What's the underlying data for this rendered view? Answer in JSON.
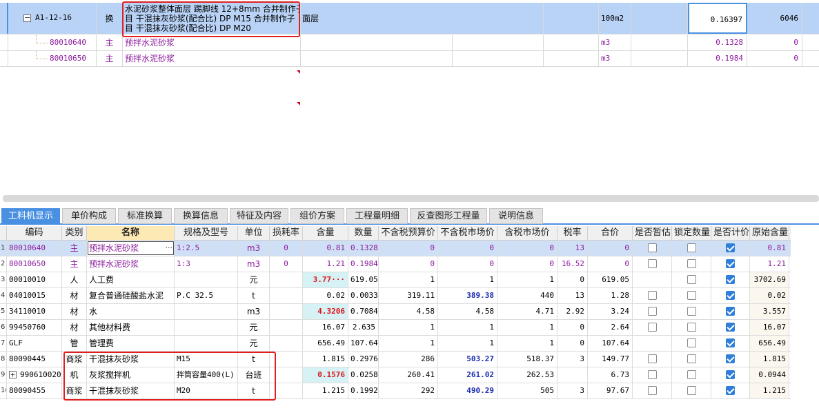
{
  "top": {
    "row1": {
      "code": "A1-12-16",
      "type": "换",
      "name_lines": [
        "水泥砂浆整体面层 踢脚线 12+8mm  合并制作子",
        "目 干混抹灰砂浆(配合比) DP M15  合并制作子",
        "目 干混抹灰砂浆(配合比) DP M20"
      ],
      "name_suffix": "面层",
      "unit": "100m2",
      "value": "0.16397",
      "amount": "6046"
    },
    "rows": [
      {
        "code": "80010640",
        "type": "主",
        "name": "预拌水泥砂浆",
        "unit": "m3",
        "value": "0.1328",
        "amount": "0"
      },
      {
        "code": "80010650",
        "type": "主",
        "name": "预拌水泥砂浆",
        "unit": "m3",
        "value": "0.1984",
        "amount": "0"
      }
    ]
  },
  "tabs": [
    "工料机显示",
    "单价构成",
    "标准换算",
    "换算信息",
    "特征及内容",
    "组价方案",
    "工程量明细",
    "反查图形工程量",
    "说明信息"
  ],
  "grid": {
    "headers": [
      "编码",
      "类别",
      "名称",
      "规格及型号",
      "单位",
      "损耗率",
      "含量",
      "数量",
      "不含税预算价",
      "不含税市场价",
      "含税市场价",
      "税率",
      "合价",
      "是否暂估",
      "锁定数量",
      "是否计价",
      "原始含量"
    ],
    "rows": [
      {
        "num": "1",
        "code": "80010640",
        "type": "主",
        "name": "预拌水泥砂浆",
        "spec": "1:2.5",
        "unit": "m3",
        "loss": "0",
        "content": "0.81",
        "qty": "0.1328",
        "budget": "0",
        "market": "0",
        "tax_market": "0",
        "rate": "13",
        "total": "0",
        "est": false,
        "lock": false,
        "price": true,
        "orig": "0.81"
      },
      {
        "num": "2",
        "code": "80010650",
        "type": "主",
        "name": "预拌水泥砂浆",
        "spec": "1:3",
        "unit": "m3",
        "loss": "0",
        "content": "1.21",
        "qty": "0.1984",
        "budget": "0",
        "market": "0",
        "tax_market": "0",
        "rate": "16.52",
        "total": "0",
        "est": false,
        "lock": false,
        "price": true,
        "orig": "1.21"
      },
      {
        "num": "3",
        "code": "00010010",
        "type": "人",
        "name": "人工费",
        "spec": "",
        "unit": "元",
        "loss": "",
        "content": "3.77···",
        "qty": "619.054",
        "budget": "1",
        "market": "1",
        "tax_market": "1",
        "rate": "0",
        "total": "619.05",
        "est": null,
        "lock": false,
        "price": true,
        "orig": "3702.69"
      },
      {
        "num": "4",
        "code": "04010015",
        "type": "材",
        "name": "复合普通硅酸盐水泥",
        "spec": "P.C 32.5",
        "unit": "t",
        "loss": "",
        "content": "0.02",
        "qty": "0.0033",
        "budget": "319.11",
        "market": "389.38",
        "tax_market": "440",
        "rate": "13",
        "total": "1.28",
        "est": false,
        "lock": false,
        "price": true,
        "orig": "0.02"
      },
      {
        "num": "5",
        "code": "34110010",
        "type": "材",
        "name": "水",
        "spec": "",
        "unit": "m3",
        "loss": "",
        "content": "4.3206",
        "qty": "0.7084",
        "budget": "4.58",
        "market": "4.58",
        "tax_market": "4.71",
        "rate": "2.92",
        "total": "3.24",
        "est": false,
        "lock": false,
        "price": true,
        "orig": "3.557"
      },
      {
        "num": "6",
        "code": "99450760",
        "type": "材",
        "name": "其他材料费",
        "spec": "",
        "unit": "元",
        "loss": "",
        "content": "16.07",
        "qty": "2.635",
        "budget": "1",
        "market": "1",
        "tax_market": "1",
        "rate": "0",
        "total": "2.64",
        "est": false,
        "lock": false,
        "price": true,
        "orig": "16.07"
      },
      {
        "num": "7",
        "code": "GLF",
        "type": "管",
        "name": "管理费",
        "spec": "",
        "unit": "元",
        "loss": "",
        "content": "656.49",
        "qty": "107.6447",
        "budget": "1",
        "market": "1",
        "tax_market": "1",
        "rate": "0",
        "total": "107.64",
        "est": null,
        "lock": false,
        "price": true,
        "orig": "656.49"
      },
      {
        "num": "8",
        "code": "80090445",
        "type": "商浆",
        "name": "干混抹灰砂浆",
        "spec": "M15",
        "unit": "t",
        "loss": "",
        "content": "1.815",
        "qty": "0.2976",
        "budget": "286",
        "market": "503.27",
        "tax_market": "518.37",
        "rate": "3",
        "total": "149.77",
        "est": false,
        "lock": false,
        "price": true,
        "orig": "1.815"
      },
      {
        "num": "9",
        "code": "990610020",
        "type": "机",
        "name": "灰浆搅拌机",
        "spec": "拌筒容量400(L)",
        "unit": "台班",
        "loss": "",
        "content": "0.1576",
        "qty": "0.0258",
        "budget": "260.41",
        "market": "261.02",
        "tax_market": "262.53",
        "rate": "",
        "total": "6.73",
        "est": false,
        "lock": false,
        "price": true,
        "orig": "0.0944"
      },
      {
        "num": "16",
        "code": "80090455",
        "type": "商浆",
        "name": "干混抹灰砂浆",
        "spec": "M20",
        "unit": "t",
        "loss": "",
        "content": "1.215",
        "qty": "0.1992",
        "budget": "292",
        "market": "490.29",
        "tax_market": "505",
        "rate": "3",
        "total": "97.67",
        "est": false,
        "lock": false,
        "price": true,
        "orig": "1.215"
      }
    ]
  },
  "colors": {
    "accent": "#4a90e2",
    "selected_row": "#b9d3f7",
    "highlight_red": "#e0161b",
    "value_blue": "#1c2fb0",
    "annotation_red": "#e02020"
  }
}
